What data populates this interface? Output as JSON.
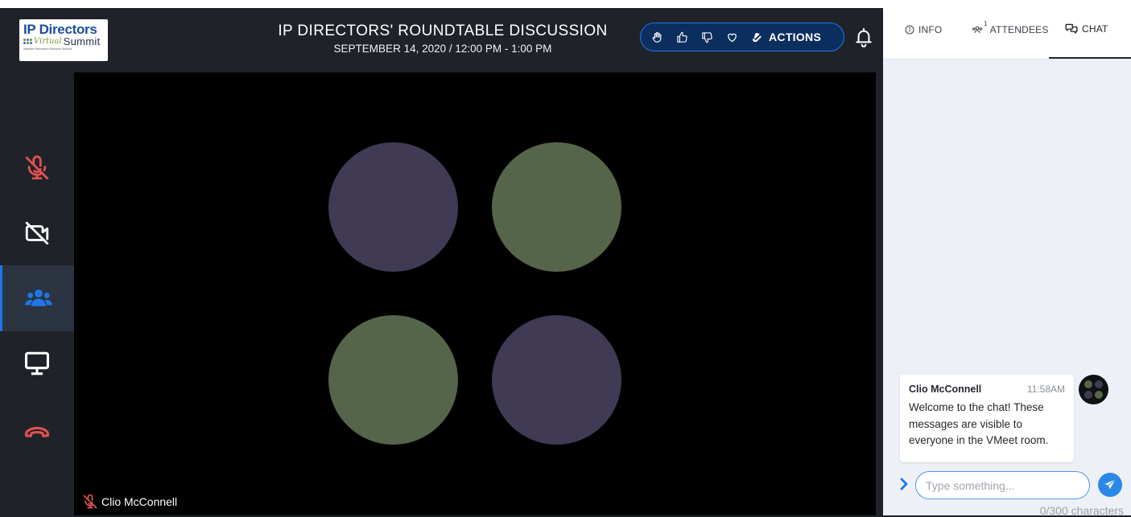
{
  "header": {
    "logo": {
      "line1": "IP Directors",
      "virtual": "Virtual",
      "summit": "Summit",
      "tagline": "Infection Prevention Directors Summit"
    },
    "title": "IP DIRECTORS' ROUNDTABLE DISCUSSION",
    "date": "SEPTEMBER 14, 2020 / 12:00 PM - 1:00 PM",
    "actions": {
      "icons": [
        "raise-hand-icon",
        "thumbs-up-icon",
        "thumbs-down-icon",
        "heart-icon",
        "clap-icon"
      ],
      "label": "ACTIONS"
    },
    "notification_icon": "bell-icon"
  },
  "sidebar": {
    "tools": [
      {
        "name": "microphone-muted",
        "icon": "mic-off-icon",
        "color": "#e05151",
        "active": false
      },
      {
        "name": "camera-off",
        "icon": "camera-off-icon",
        "color": "#ffffff",
        "active": false
      },
      {
        "name": "participants",
        "icon": "users-icon",
        "color": "#1d77e8",
        "active": true
      },
      {
        "name": "screen-share",
        "icon": "monitor-icon",
        "color": "#ffffff",
        "active": false
      },
      {
        "name": "leave-call",
        "icon": "phone-hangup-icon",
        "color": "#e05151",
        "active": false
      }
    ]
  },
  "video": {
    "participant_name": "Clio McConnell",
    "muted": true,
    "tiles": [
      {
        "color": "#403a55"
      },
      {
        "color": "#56644a"
      },
      {
        "color": "#56644a"
      },
      {
        "color": "#403a55"
      }
    ]
  },
  "panel": {
    "tabs": [
      {
        "label": "INFO",
        "icon": "info-icon",
        "active": false
      },
      {
        "label": "ATTENDEES",
        "icon": "attendees-icon",
        "badge": "1",
        "active": false
      },
      {
        "label": "CHAT",
        "icon": "chat-icon",
        "active": true
      }
    ],
    "messages": [
      {
        "author": "Clio McConnell",
        "time": "11:58AM",
        "text": "Welcome to the chat! These messages are visible to everyone in the VMeet room."
      }
    ],
    "composer": {
      "placeholder": "Type something...",
      "value": "",
      "counter": "0/300 characters"
    }
  },
  "colors": {
    "accent": "#1d77e8",
    "danger": "#e05151",
    "background": "#1f2329"
  }
}
